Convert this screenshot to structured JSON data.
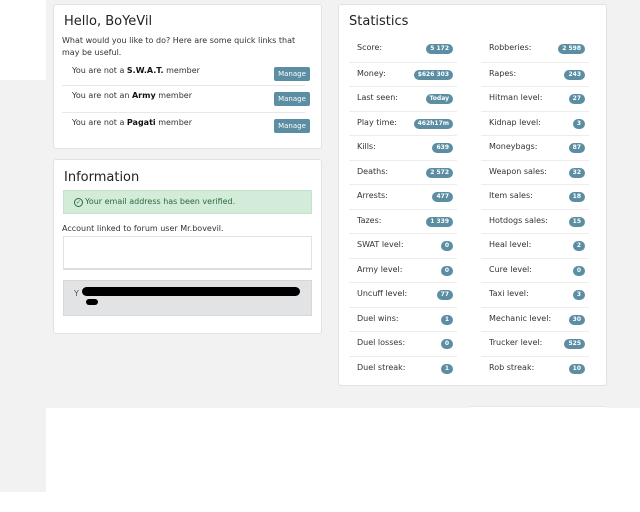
{
  "hello": {
    "title": "Hello, BoYeVil",
    "intro": "What would you like to do? Here are some quick links that may be useful.",
    "memberships": [
      {
        "prefix": "You are not a ",
        "group": "S.W.A.T.",
        "suffix": " member",
        "button": "Manage"
      },
      {
        "prefix": "You are not an ",
        "group": "Army",
        "suffix": " member",
        "button": "Manage"
      },
      {
        "prefix": "You are not a ",
        "group": "Pagati",
        "suffix": " member",
        "button": "Manage"
      }
    ]
  },
  "info": {
    "title": "Information",
    "alert_icon": "check-circle-icon",
    "alert": "Your email address has been verified.",
    "linked": "Account linked to forum user Mr.bovevil.",
    "redacted_prefix": "Y"
  },
  "stats": {
    "title": "Statistics",
    "left": [
      {
        "label": "Score:",
        "value": "5 172"
      },
      {
        "label": "Money:",
        "value": "$626 303"
      },
      {
        "label": "Last seen:",
        "value": "Today"
      },
      {
        "label": "Play time:",
        "value": "462h17m"
      },
      {
        "label": "Kills:",
        "value": "639"
      },
      {
        "label": "Deaths:",
        "value": "2 572"
      },
      {
        "label": "Arrests:",
        "value": "477"
      },
      {
        "label": "Tazes:",
        "value": "1 339"
      },
      {
        "label": "SWAT level:",
        "value": "0"
      },
      {
        "label": "Army level:",
        "value": "0"
      },
      {
        "label": "Uncuff level:",
        "value": "77"
      },
      {
        "label": "Duel wins:",
        "value": "1"
      },
      {
        "label": "Duel losses:",
        "value": "0"
      },
      {
        "label": "Duel streak:",
        "value": "1"
      }
    ],
    "right": [
      {
        "label": "Robberies:",
        "value": "2 598"
      },
      {
        "label": "Rapes:",
        "value": "243"
      },
      {
        "label": "Hitman level:",
        "value": "27"
      },
      {
        "label": "Kidnap level:",
        "value": "3"
      },
      {
        "label": "Moneybags:",
        "value": "87"
      },
      {
        "label": "Weapon sales:",
        "value": "32"
      },
      {
        "label": "Item sales:",
        "value": "18"
      },
      {
        "label": "Hotdogs sales:",
        "value": "15"
      },
      {
        "label": "Heal level:",
        "value": "2"
      },
      {
        "label": "Cure level:",
        "value": "0"
      },
      {
        "label": "Taxi level:",
        "value": "3"
      },
      {
        "label": "Mechanic level:",
        "value": "30"
      },
      {
        "label": "Trucker level:",
        "value": "525"
      },
      {
        "label": "Rob streak:",
        "value": "10"
      }
    ]
  }
}
